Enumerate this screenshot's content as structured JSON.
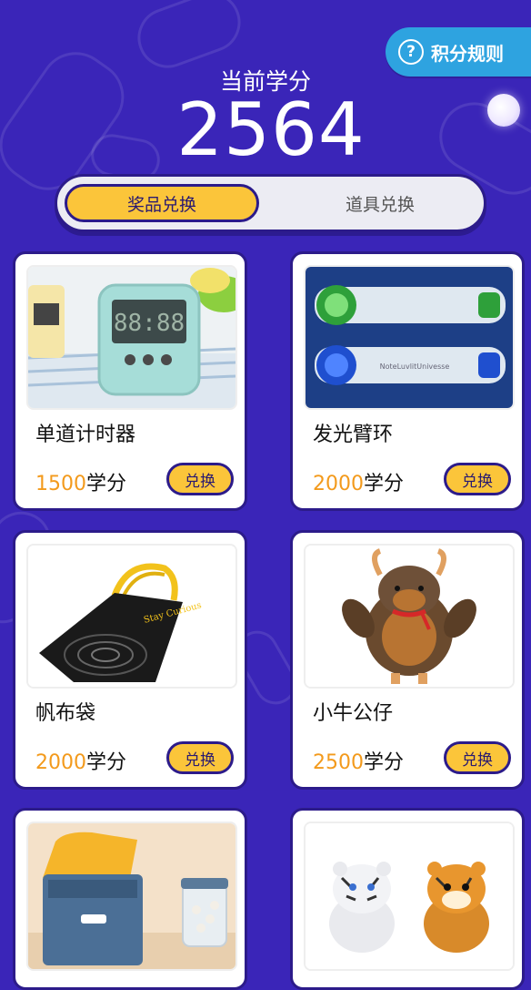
{
  "header": {
    "rules_label": "积分规则",
    "rules_icon": "question-circle-icon",
    "credit_label": "当前学分",
    "credit_value": "2564"
  },
  "tabs": [
    {
      "label": "奖品兑换",
      "active": true
    },
    {
      "label": "道具兑换",
      "active": false
    }
  ],
  "products": [
    {
      "name": "单道计时器",
      "price": "1500",
      "unit": "学分",
      "button": "兑换",
      "image": "digital-timer-image"
    },
    {
      "name": "发光臂环",
      "price": "2000",
      "unit": "学分",
      "button": "兑换",
      "image": "light-armband-image"
    },
    {
      "name": "帆布袋",
      "price": "2000",
      "unit": "学分",
      "button": "兑换",
      "image": "canvas-bag-image"
    },
    {
      "name": "小牛公仔",
      "price": "2500",
      "unit": "学分",
      "button": "兑换",
      "image": "calf-plush-image"
    },
    {
      "name": "",
      "price": "",
      "unit": "",
      "button": "",
      "image": "storage-bin-image"
    },
    {
      "name": "",
      "price": "",
      "unit": "",
      "button": "",
      "image": "tiger-plush-image"
    }
  ],
  "colors": {
    "background": "#3a25b8",
    "accent_yellow": "#fbc53a",
    "price_orange": "#f39a1c",
    "rules_blue": "#2ea3e0"
  }
}
